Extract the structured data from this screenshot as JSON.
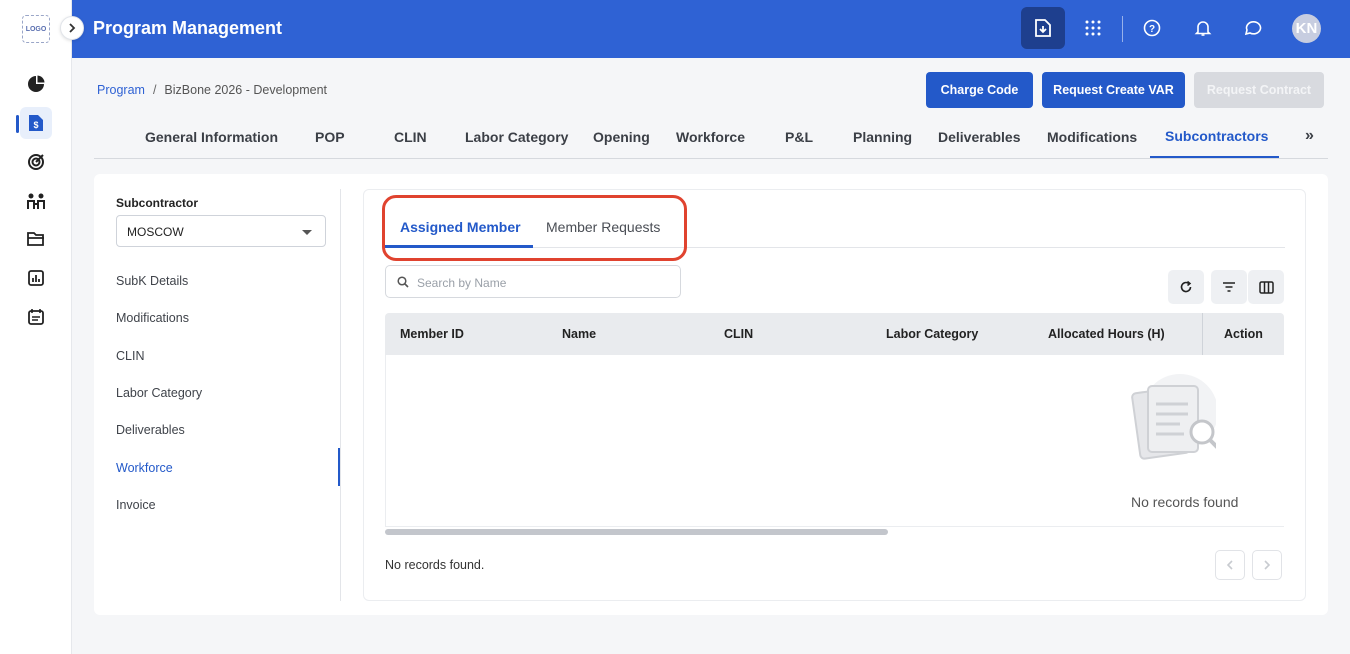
{
  "app": {
    "logo_text": "LOGO",
    "title": "Program Management",
    "avatar_initials": "KN"
  },
  "breadcrumb": {
    "root": "Program",
    "separator": "/",
    "current": "BizBone 2026 - Development"
  },
  "actions": {
    "charge_code": "Charge Code",
    "request_var": "Request Create VAR",
    "request_contract": "Request Contract"
  },
  "tabs": {
    "items": [
      "General Information",
      "POP",
      "CLIN",
      "Labor Category",
      "Opening",
      "Workforce",
      "P&L",
      "Planning",
      "Deliverables",
      "Modifications",
      "Subcontractors"
    ],
    "more": "»"
  },
  "subcontractor": {
    "label": "Subcontractor",
    "selected": "MOSCOW",
    "menu": [
      "SubK Details",
      "Modifications",
      "CLIN",
      "Labor Category",
      "Deliverables",
      "Workforce",
      "Invoice"
    ]
  },
  "workforce": {
    "subtabs": [
      "Assigned Member",
      "Member Requests"
    ],
    "search_placeholder": "Search by Name",
    "columns": [
      "Member ID",
      "Name",
      "CLIN",
      "Labor Category",
      "Allocated Hours (H)",
      "Action"
    ],
    "empty_text": "No records found",
    "footer_text": "No records found."
  },
  "colors": {
    "primary": "#2f62d4",
    "accent": "#2359c9",
    "highlight": "#e0432f"
  }
}
